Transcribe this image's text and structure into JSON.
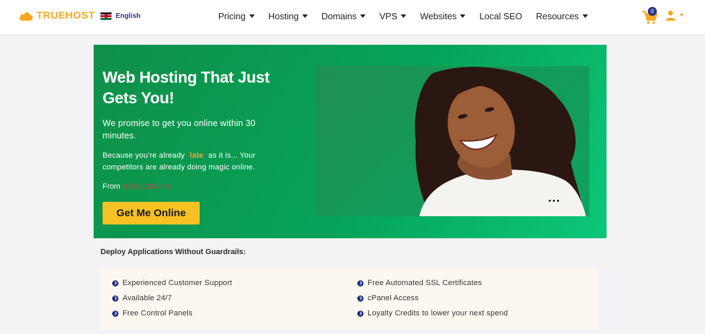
{
  "brand": {
    "name": "TRUEHOST",
    "accent": "#f7a823",
    "navy": "#283688"
  },
  "language": {
    "label": "English",
    "flag": "kenya-flag"
  },
  "nav": {
    "items": [
      {
        "label": "Pricing",
        "dropdown": true
      },
      {
        "label": "Hosting",
        "dropdown": true
      },
      {
        "label": "Domains",
        "dropdown": true
      },
      {
        "label": "VPS",
        "dropdown": true
      },
      {
        "label": "Websites",
        "dropdown": true
      },
      {
        "label": "Local SEO",
        "dropdown": false
      },
      {
        "label": "Resources",
        "dropdown": true
      }
    ]
  },
  "cart": {
    "count": "0",
    "icon": "cart-icon"
  },
  "user": {
    "icon": "user-icon"
  },
  "hero": {
    "title": "Web Hosting That Just Gets You!",
    "subtitle": "We promise to get you online within 30 minutes.",
    "body_before": "Because you’re already",
    "body_highlight": "late",
    "body_after": "as it is... Your competitors are already doing magic online.",
    "from_label": "From",
    "from_price": "KSh 1,300/mo",
    "cta_label": "Get Me Online",
    "bg_start": "#109048",
    "bg_end": "#0cc77a"
  },
  "features": {
    "heading": "Deploy Applications Without Guardrails:",
    "left": [
      "Experienced Customer Support",
      "Available 24/7",
      "Free Control Panels"
    ],
    "right": [
      "Free Automated SSL Certificates",
      "cPanel Access",
      "Loyalty Credits to lower your next spend"
    ]
  }
}
